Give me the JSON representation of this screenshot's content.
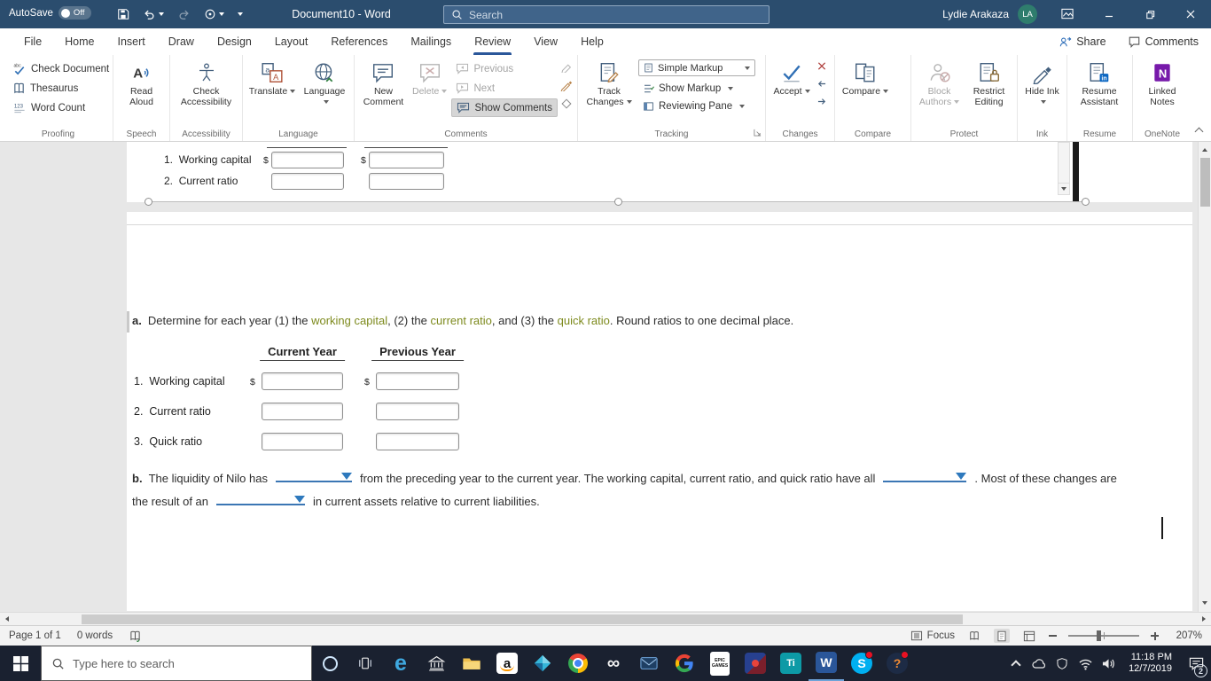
{
  "titlebar": {
    "autosave": {
      "label": "AutoSave",
      "state": "Off"
    },
    "doc_title": "Document10 - Word",
    "search_placeholder": "Search",
    "user": {
      "name": "Lydie Arakaza",
      "initials": "LA"
    }
  },
  "menubar": {
    "tabs": [
      "File",
      "Home",
      "Insert",
      "Draw",
      "Design",
      "Layout",
      "References",
      "Mailings",
      "Review",
      "View",
      "Help"
    ],
    "share_label": "Share",
    "comments_label": "Comments"
  },
  "ribbon": {
    "proofing": {
      "check_document": "Check Document",
      "thesaurus": "Thesaurus",
      "word_count": "Word Count",
      "label": "Proofing"
    },
    "speech": {
      "read_aloud": "Read Aloud",
      "label": "Speech"
    },
    "accessibility": {
      "check_accessibility": "Check Accessibility",
      "label": "Accessibility"
    },
    "language": {
      "translate": "Translate",
      "language": "Language",
      "label": "Language"
    },
    "comments": {
      "new_comment": "New Comment",
      "delete": "Delete",
      "previous": "Previous",
      "next": "Next",
      "show_comments": "Show Comments",
      "label": "Comments"
    },
    "tracking": {
      "track_changes": "Track Changes",
      "markup_value": "Simple Markup",
      "show_markup": "Show Markup",
      "reviewing_pane": "Reviewing Pane",
      "label": "Tracking"
    },
    "changes": {
      "accept": "Accept",
      "label": "Changes"
    },
    "compare": {
      "compare": "Compare",
      "label": "Compare"
    },
    "protect": {
      "block_authors": "Block Authors",
      "restrict_editing": "Restrict Editing",
      "label": "Protect"
    },
    "ink": {
      "hide_ink": "Hide Ink",
      "label": "Ink"
    },
    "resume": {
      "resume_assistant": "Resume Assistant",
      "label": "Resume"
    },
    "onenote": {
      "linked_notes": "Linked Notes",
      "label": "OneNote"
    }
  },
  "doc": {
    "table": {
      "col1": "Current Year",
      "col2": "Previous Year",
      "r1num": "1.",
      "r1label": "Working capital",
      "r1cur": "$",
      "r2num": "2.",
      "r2label": "Current ratio",
      "r3num": "3.",
      "r3label": "Quick ratio"
    },
    "item_a": {
      "marker": "a.",
      "seg1": "Determine for each year (1) the ",
      "term1": "working capital",
      "seg2": ", (2) the ",
      "term2": "current ratio",
      "seg3": ", and (3) the ",
      "term3": "quick ratio",
      "seg4": ". Round ratios to one decimal place."
    },
    "item_b": {
      "marker": "b.",
      "seg1": "The liquidity of Nilo has",
      "seg2": "from the preceding year to the current year. The working capital, current ratio, and quick ratio have all",
      "seg3": ". Most of these changes are",
      "line2a": "the result of an",
      "line2b": "in current assets relative to current liabilities."
    }
  },
  "statusbar": {
    "page_info": "Page 1 of 1",
    "word_count": "0 words",
    "focus_label": "Focus",
    "zoom_level": "207%"
  },
  "taskbar": {
    "search_placeholder": "Type here to search",
    "time": "11:18 PM",
    "date": "12/7/2019",
    "notification_badge": "2",
    "glyphs": {
      "edge": "e",
      "amazon": "a",
      "infinity": "∞",
      "ti": "Ti",
      "word": "W",
      "skype": "S",
      "help": "?",
      "epic1": "EPIC",
      "epic2": "GAMES"
    }
  }
}
